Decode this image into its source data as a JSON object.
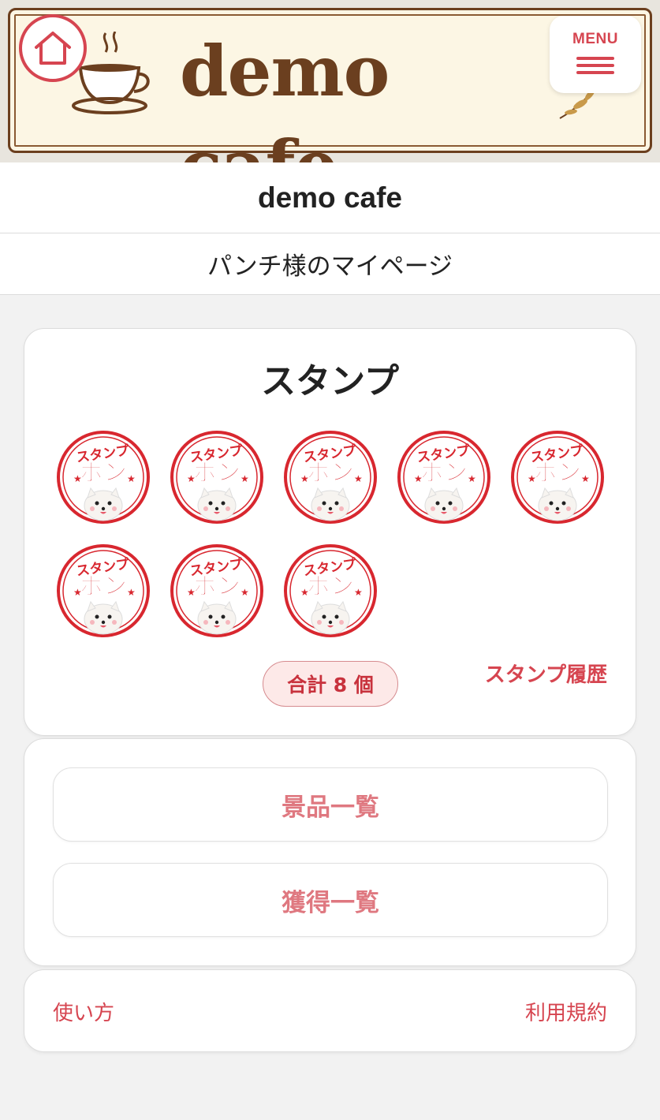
{
  "banner": {
    "title": "demo cafe",
    "menu_label": "MENU",
    "home_icon": "home-icon",
    "cup_icon": "coffee-cup-icon"
  },
  "shop": {
    "name": "demo cafe"
  },
  "mypage": {
    "title": "パンチ様のマイページ"
  },
  "stamps": {
    "heading": "スタンプ",
    "count": 8,
    "stamp_text_top": "スタンプ",
    "stamp_text_main": "ポン",
    "total_label": "合計 8 個",
    "history_link": "スタンプ履歴"
  },
  "prizes": {
    "list_button": "景品一覧",
    "acquired_button": "獲得一覧"
  },
  "footer": {
    "how_to": "使い方",
    "terms": "利用規約"
  },
  "colors": {
    "accent": "#d64550",
    "brown": "#6b3f1f",
    "cream": "#fcf6e4",
    "background": "#f2f2f2"
  }
}
